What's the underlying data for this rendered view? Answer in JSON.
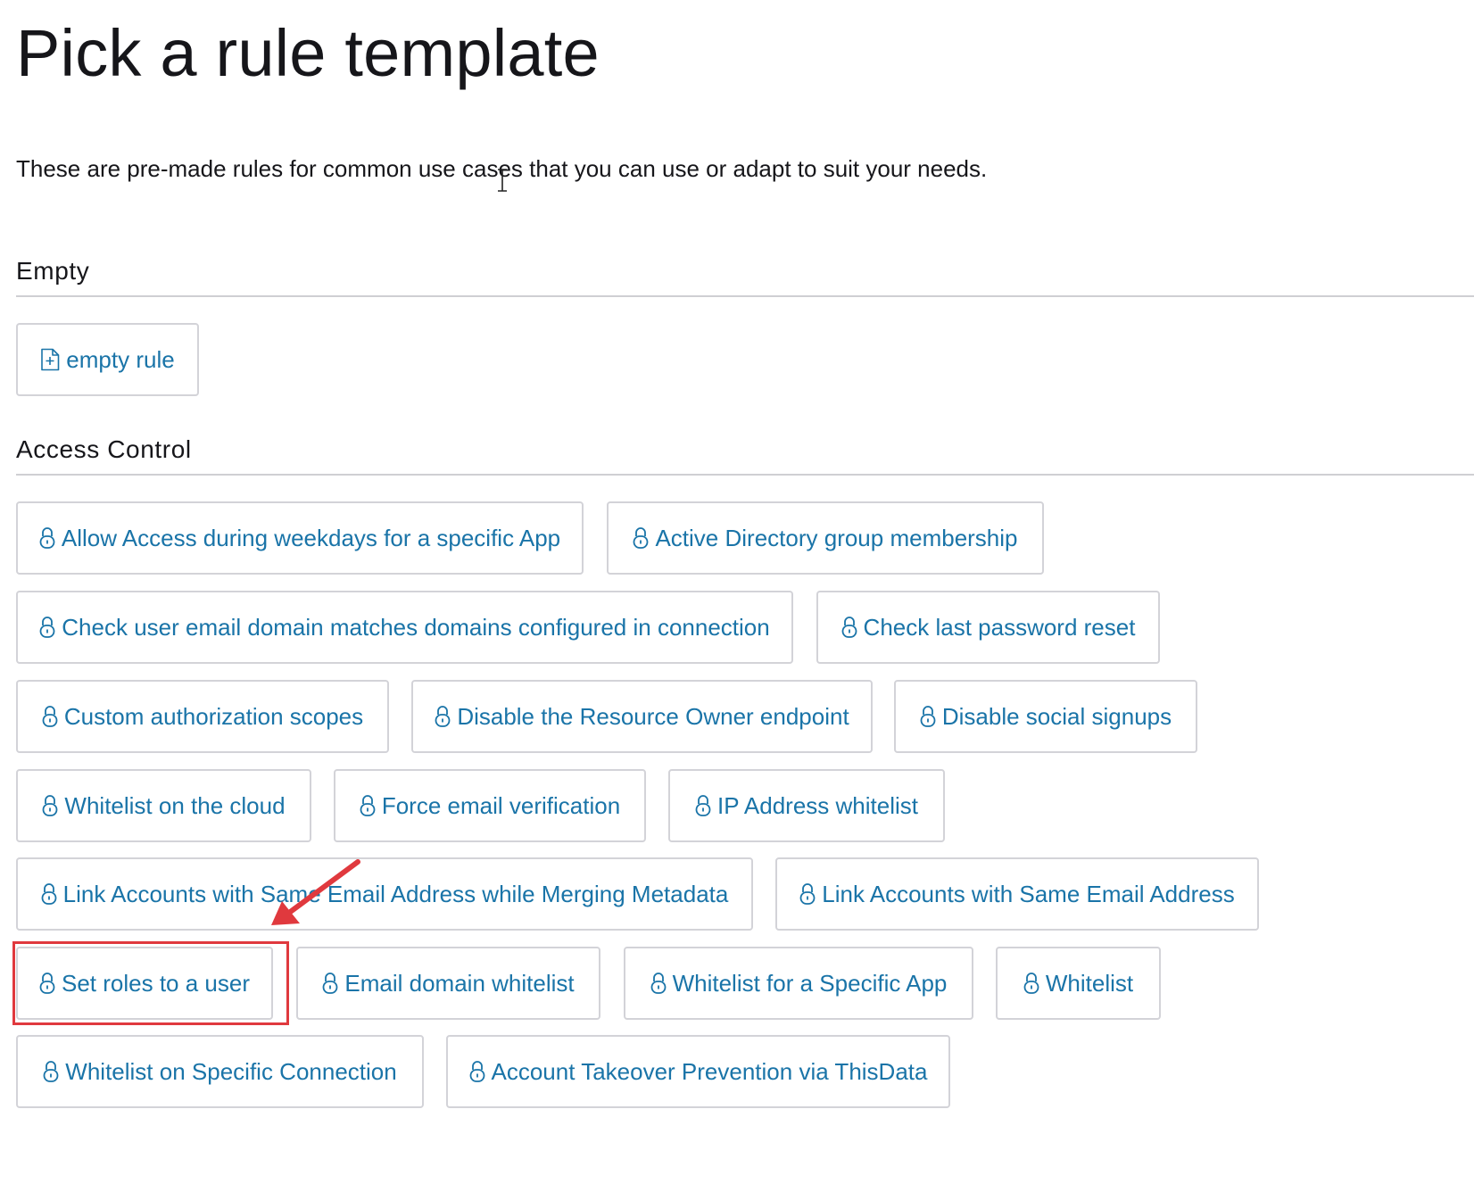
{
  "page": {
    "title": "Pick a rule template",
    "intro": "These are pre-made rules for common use cases that you can use or adapt to suit your needs."
  },
  "sections": [
    {
      "title": "Empty",
      "items": [
        {
          "label": "empty rule",
          "icon": "new-file-icon"
        }
      ]
    },
    {
      "title": "Access Control",
      "items": [
        {
          "label": "Allow Access during weekdays for a specific App",
          "icon": "lock-icon"
        },
        {
          "label": "Active Directory group membership",
          "icon": "lock-icon"
        },
        {
          "label": "Check user email domain matches domains configured in connection",
          "icon": "lock-icon"
        },
        {
          "label": "Check last password reset",
          "icon": "lock-icon"
        },
        {
          "label": "Custom authorization scopes",
          "icon": "lock-icon"
        },
        {
          "label": "Disable the Resource Owner endpoint",
          "icon": "lock-icon"
        },
        {
          "label": "Disable social signups",
          "icon": "lock-icon"
        },
        {
          "label": "Whitelist on the cloud",
          "icon": "lock-icon"
        },
        {
          "label": "Force email verification",
          "icon": "lock-icon"
        },
        {
          "label": "IP Address whitelist",
          "icon": "lock-icon"
        },
        {
          "label": "Link Accounts with Same Email Address while Merging Metadata",
          "icon": "lock-icon"
        },
        {
          "label": "Link Accounts with Same Email Address",
          "icon": "lock-icon"
        },
        {
          "label": "Set roles to a user",
          "icon": "lock-icon",
          "highlighted": true
        },
        {
          "label": "Email domain whitelist",
          "icon": "lock-icon"
        },
        {
          "label": "Whitelist for a Specific App",
          "icon": "lock-icon"
        },
        {
          "label": "Whitelist",
          "icon": "lock-icon"
        },
        {
          "label": "Whitelist on Specific Connection",
          "icon": "lock-icon"
        },
        {
          "label": "Account Takeover Prevention via ThisData",
          "icon": "lock-icon"
        }
      ]
    }
  ],
  "annotations": {
    "highlight_color": "#e0393e",
    "arrow_color": "#e0393e",
    "highlighted_item": "Set roles to a user"
  },
  "colors": {
    "link": "#1a74a8",
    "border": "#d3d3d8",
    "text": "#16161a"
  }
}
